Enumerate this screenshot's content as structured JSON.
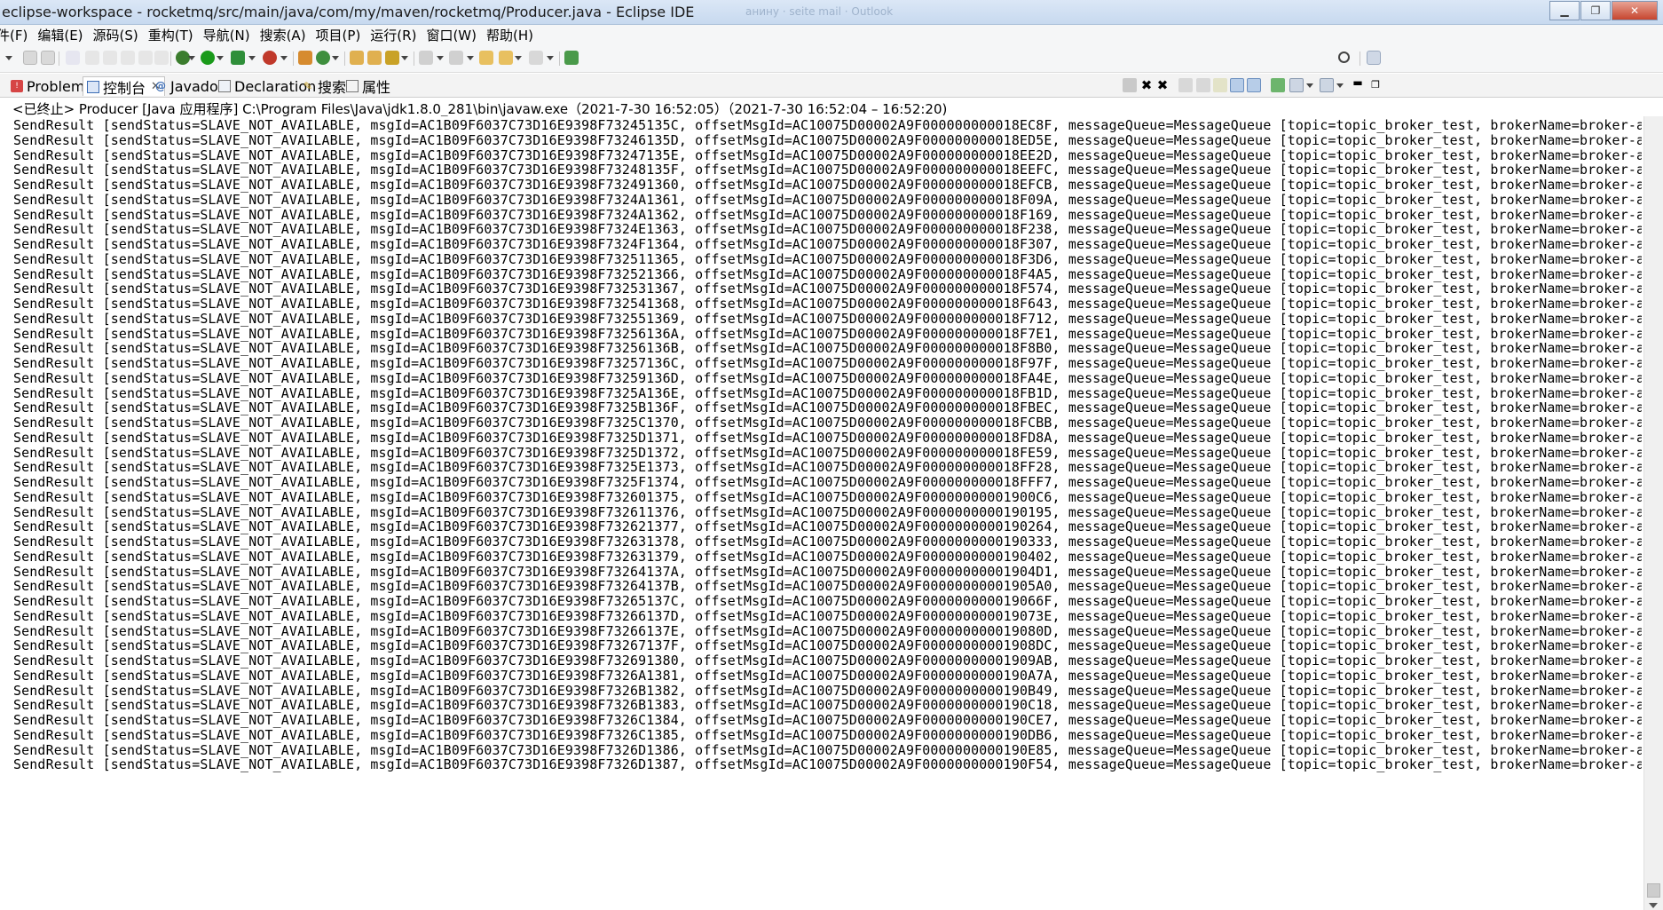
{
  "window": {
    "title": "eclipse-workspace - rocketmq/src/main/java/com/my/maven/rocketmq/Producer.java - Eclipse IDE",
    "ghost_text": "анину · seite mail · Outlook",
    "minimize_icon": "minimize-icon",
    "maximize_icon": "maximize-icon",
    "close_icon": "close-icon"
  },
  "menubar": {
    "items": [
      "件(F)",
      "编辑(E)",
      "源码(S)",
      "重构(T)",
      "导航(N)",
      "搜索(A)",
      "项目(P)",
      "运行(R)",
      "窗口(W)",
      "帮助(H)"
    ]
  },
  "toolbar": {
    "icons": [
      "new-icon",
      "save-icon",
      "save-all-icon",
      "debug-icon",
      "run-icon",
      "coverage-icon",
      "external-tools-icon",
      "new-java-project-icon",
      "new-class-icon",
      "open-type-icon",
      "search-icon",
      "next-annotation-icon",
      "back-icon",
      "forward-icon",
      "pin-editor-icon",
      "quick-access-search-icon",
      "perspective-icon"
    ]
  },
  "views": {
    "tabs": [
      {
        "label": "Problems",
        "icon": "problems-icon",
        "active": false
      },
      {
        "label": "控制台",
        "icon": "console-icon",
        "active": true
      },
      {
        "label": "Javadoc",
        "icon": "javadoc-icon",
        "active": false
      },
      {
        "label": "Declaration",
        "icon": "declaration-icon",
        "active": false
      },
      {
        "label": "搜索",
        "icon": "search-view-icon",
        "active": false
      },
      {
        "label": "属性",
        "icon": "properties-icon",
        "active": false
      }
    ],
    "close_glyph": "✕",
    "toolbar_icons": [
      "terminate-icon",
      "remove-launch-icon",
      "remove-all-terminated-icon",
      "clear-console-icon",
      "scroll-lock-icon",
      "word-wrap-icon",
      "show-on-stdout-icon",
      "show-on-stderr-icon",
      "pin-console-icon",
      "display-console-icon",
      "open-console-icon",
      "minimize-view-icon",
      "maximize-view-icon"
    ]
  },
  "console": {
    "header": "<已终止> Producer [Java 应用程序] C:\\Program Files\\Java\\jdk1.8.0_281\\bin\\javaw.exe（2021-7-30 16:52:05）（2021-7-30 16:52:04 – 16:52:20)",
    "lines": [
      "SendResult [sendStatus=SLAVE_NOT_AVAILABLE, msgId=AC1B09F6037C73D16E9398F73245135C, offsetMsgId=AC10075D00002A9F000000000018EC8F, messageQueue=MessageQueue [topic=topic_broker_test, brokerName=broker-a,",
      "SendResult [sendStatus=SLAVE_NOT_AVAILABLE, msgId=AC1B09F6037C73D16E9398F73246135D, offsetMsgId=AC10075D00002A9F000000000018ED5E, messageQueue=MessageQueue [topic=topic_broker_test, brokerName=broker-a,",
      "SendResult [sendStatus=SLAVE_NOT_AVAILABLE, msgId=AC1B09F6037C73D16E9398F73247135E, offsetMsgId=AC10075D00002A9F000000000018EE2D, messageQueue=MessageQueue [topic=topic_broker_test, brokerName=broker-a,",
      "SendResult [sendStatus=SLAVE_NOT_AVAILABLE, msgId=AC1B09F6037C73D16E9398F73248135F, offsetMsgId=AC10075D00002A9F000000000018EEFC, messageQueue=MessageQueue [topic=topic_broker_test, brokerName=broker-a,",
      "SendResult [sendStatus=SLAVE_NOT_AVAILABLE, msgId=AC1B09F6037C73D16E9398F732491360, offsetMsgId=AC10075D00002A9F000000000018EFCB, messageQueue=MessageQueue [topic=topic_broker_test, brokerName=broker-a,",
      "SendResult [sendStatus=SLAVE_NOT_AVAILABLE, msgId=AC1B09F6037C73D16E9398F7324A1361, offsetMsgId=AC10075D00002A9F000000000018F09A, messageQueue=MessageQueue [topic=topic_broker_test, brokerName=broker-a,",
      "SendResult [sendStatus=SLAVE_NOT_AVAILABLE, msgId=AC1B09F6037C73D16E9398F7324A1362, offsetMsgId=AC10075D00002A9F000000000018F169, messageQueue=MessageQueue [topic=topic_broker_test, brokerName=broker-a,",
      "SendResult [sendStatus=SLAVE_NOT_AVAILABLE, msgId=AC1B09F6037C73D16E9398F7324E1363, offsetMsgId=AC10075D00002A9F000000000018F238, messageQueue=MessageQueue [topic=topic_broker_test, brokerName=broker-a,",
      "SendResult [sendStatus=SLAVE_NOT_AVAILABLE, msgId=AC1B09F6037C73D16E9398F7324F1364, offsetMsgId=AC10075D00002A9F000000000018F307, messageQueue=MessageQueue [topic=topic_broker_test, brokerName=broker-a,",
      "SendResult [sendStatus=SLAVE_NOT_AVAILABLE, msgId=AC1B09F6037C73D16E9398F732511365, offsetMsgId=AC10075D00002A9F000000000018F3D6, messageQueue=MessageQueue [topic=topic_broker_test, brokerName=broker-a,",
      "SendResult [sendStatus=SLAVE_NOT_AVAILABLE, msgId=AC1B09F6037C73D16E9398F732521366, offsetMsgId=AC10075D00002A9F000000000018F4A5, messageQueue=MessageQueue [topic=topic_broker_test, brokerName=broker-a,",
      "SendResult [sendStatus=SLAVE_NOT_AVAILABLE, msgId=AC1B09F6037C73D16E9398F732531367, offsetMsgId=AC10075D00002A9F000000000018F574, messageQueue=MessageQueue [topic=topic_broker_test, brokerName=broker-a,",
      "SendResult [sendStatus=SLAVE_NOT_AVAILABLE, msgId=AC1B09F6037C73D16E9398F732541368, offsetMsgId=AC10075D00002A9F000000000018F643, messageQueue=MessageQueue [topic=topic_broker_test, brokerName=broker-a,",
      "SendResult [sendStatus=SLAVE_NOT_AVAILABLE, msgId=AC1B09F6037C73D16E9398F732551369, offsetMsgId=AC10075D00002A9F000000000018F712, messageQueue=MessageQueue [topic=topic_broker_test, brokerName=broker-a,",
      "SendResult [sendStatus=SLAVE_NOT_AVAILABLE, msgId=AC1B09F6037C73D16E9398F73256136A, offsetMsgId=AC10075D00002A9F000000000018F7E1, messageQueue=MessageQueue [topic=topic_broker_test, brokerName=broker-a,",
      "SendResult [sendStatus=SLAVE_NOT_AVAILABLE, msgId=AC1B09F6037C73D16E9398F73256136B, offsetMsgId=AC10075D00002A9F000000000018F8B0, messageQueue=MessageQueue [topic=topic_broker_test, brokerName=broker-a,",
      "SendResult [sendStatus=SLAVE_NOT_AVAILABLE, msgId=AC1B09F6037C73D16E9398F73257136C, offsetMsgId=AC10075D00002A9F000000000018F97F, messageQueue=MessageQueue [topic=topic_broker_test, brokerName=broker-a,",
      "SendResult [sendStatus=SLAVE_NOT_AVAILABLE, msgId=AC1B09F6037C73D16E9398F73259136D, offsetMsgId=AC10075D00002A9F000000000018FA4E, messageQueue=MessageQueue [topic=topic_broker_test, brokerName=broker-a,",
      "SendResult [sendStatus=SLAVE_NOT_AVAILABLE, msgId=AC1B09F6037C73D16E9398F7325A136E, offsetMsgId=AC10075D00002A9F000000000018FB1D, messageQueue=MessageQueue [topic=topic_broker_test, brokerName=broker-a,",
      "SendResult [sendStatus=SLAVE_NOT_AVAILABLE, msgId=AC1B09F6037C73D16E9398F7325B136F, offsetMsgId=AC10075D00002A9F000000000018FBEC, messageQueue=MessageQueue [topic=topic_broker_test, brokerName=broker-a,",
      "SendResult [sendStatus=SLAVE_NOT_AVAILABLE, msgId=AC1B09F6037C73D16E9398F7325C1370, offsetMsgId=AC10075D00002A9F000000000018FCBB, messageQueue=MessageQueue [topic=topic_broker_test, brokerName=broker-a,",
      "SendResult [sendStatus=SLAVE_NOT_AVAILABLE, msgId=AC1B09F6037C73D16E9398F7325D1371, offsetMsgId=AC10075D00002A9F000000000018FD8A, messageQueue=MessageQueue [topic=topic_broker_test, brokerName=broker-a,",
      "SendResult [sendStatus=SLAVE_NOT_AVAILABLE, msgId=AC1B09F6037C73D16E9398F7325D1372, offsetMsgId=AC10075D00002A9F000000000018FE59, messageQueue=MessageQueue [topic=topic_broker_test, brokerName=broker-a,",
      "SendResult [sendStatus=SLAVE_NOT_AVAILABLE, msgId=AC1B09F6037C73D16E9398F7325E1373, offsetMsgId=AC10075D00002A9F000000000018FF28, messageQueue=MessageQueue [topic=topic_broker_test, brokerName=broker-a,",
      "SendResult [sendStatus=SLAVE_NOT_AVAILABLE, msgId=AC1B09F6037C73D16E9398F7325F1374, offsetMsgId=AC10075D00002A9F000000000018FFF7, messageQueue=MessageQueue [topic=topic_broker_test, brokerName=broker-a,",
      "SendResult [sendStatus=SLAVE_NOT_AVAILABLE, msgId=AC1B09F6037C73D16E9398F732601375, offsetMsgId=AC10075D00002A9F00000000001900C6, messageQueue=MessageQueue [topic=topic_broker_test, brokerName=broker-a,",
      "SendResult [sendStatus=SLAVE_NOT_AVAILABLE, msgId=AC1B09F6037C73D16E9398F732611376, offsetMsgId=AC10075D00002A9F0000000000190195, messageQueue=MessageQueue [topic=topic_broker_test, brokerName=broker-a,",
      "SendResult [sendStatus=SLAVE_NOT_AVAILABLE, msgId=AC1B09F6037C73D16E9398F732621377, offsetMsgId=AC10075D00002A9F0000000000190264, messageQueue=MessageQueue [topic=topic_broker_test, brokerName=broker-a,",
      "SendResult [sendStatus=SLAVE_NOT_AVAILABLE, msgId=AC1B09F6037C73D16E9398F732631378, offsetMsgId=AC10075D00002A9F0000000000190333, messageQueue=MessageQueue [topic=topic_broker_test, brokerName=broker-a,",
      "SendResult [sendStatus=SLAVE_NOT_AVAILABLE, msgId=AC1B09F6037C73D16E9398F732631379, offsetMsgId=AC10075D00002A9F0000000000190402, messageQueue=MessageQueue [topic=topic_broker_test, brokerName=broker-a,",
      "SendResult [sendStatus=SLAVE_NOT_AVAILABLE, msgId=AC1B09F6037C73D16E9398F73264137A, offsetMsgId=AC10075D00002A9F00000000001904D1, messageQueue=MessageQueue [topic=topic_broker_test, brokerName=broker-a,",
      "SendResult [sendStatus=SLAVE_NOT_AVAILABLE, msgId=AC1B09F6037C73D16E9398F73264137B, offsetMsgId=AC10075D00002A9F00000000001905A0, messageQueue=MessageQueue [topic=topic_broker_test, brokerName=broker-a,",
      "SendResult [sendStatus=SLAVE_NOT_AVAILABLE, msgId=AC1B09F6037C73D16E9398F73265137C, offsetMsgId=AC10075D00002A9F000000000019066F, messageQueue=MessageQueue [topic=topic_broker_test, brokerName=broker-a,",
      "SendResult [sendStatus=SLAVE_NOT_AVAILABLE, msgId=AC1B09F6037C73D16E9398F73266137D, offsetMsgId=AC10075D00002A9F000000000019073E, messageQueue=MessageQueue [topic=topic_broker_test, brokerName=broker-a,",
      "SendResult [sendStatus=SLAVE_NOT_AVAILABLE, msgId=AC1B09F6037C73D16E9398F73266137E, offsetMsgId=AC10075D00002A9F000000000019080D, messageQueue=MessageQueue [topic=topic_broker_test, brokerName=broker-a,",
      "SendResult [sendStatus=SLAVE_NOT_AVAILABLE, msgId=AC1B09F6037C73D16E9398F73267137F, offsetMsgId=AC10075D00002A9F00000000001908DC, messageQueue=MessageQueue [topic=topic_broker_test, brokerName=broker-a,",
      "SendResult [sendStatus=SLAVE_NOT_AVAILABLE, msgId=AC1B09F6037C73D16E9398F732691380, offsetMsgId=AC10075D00002A9F00000000001909AB, messageQueue=MessageQueue [topic=topic_broker_test, brokerName=broker-a,",
      "SendResult [sendStatus=SLAVE_NOT_AVAILABLE, msgId=AC1B09F6037C73D16E9398F7326A1381, offsetMsgId=AC10075D00002A9F0000000000190A7A, messageQueue=MessageQueue [topic=topic_broker_test, brokerName=broker-a,",
      "SendResult [sendStatus=SLAVE_NOT_AVAILABLE, msgId=AC1B09F6037C73D16E9398F7326B1382, offsetMsgId=AC10075D00002A9F0000000000190B49, messageQueue=MessageQueue [topic=topic_broker_test, brokerName=broker-a,",
      "SendResult [sendStatus=SLAVE_NOT_AVAILABLE, msgId=AC1B09F6037C73D16E9398F7326B1383, offsetMsgId=AC10075D00002A9F0000000000190C18, messageQueue=MessageQueue [topic=topic_broker_test, brokerName=broker-a,",
      "SendResult [sendStatus=SLAVE_NOT_AVAILABLE, msgId=AC1B09F6037C73D16E9398F7326C1384, offsetMsgId=AC10075D00002A9F0000000000190CE7, messageQueue=MessageQueue [topic=topic_broker_test, brokerName=broker-a,",
      "SendResult [sendStatus=SLAVE_NOT_AVAILABLE, msgId=AC1B09F6037C73D16E9398F7326C1385, offsetMsgId=AC10075D00002A9F0000000000190DB6, messageQueue=MessageQueue [topic=topic_broker_test, brokerName=broker-a,",
      "SendResult [sendStatus=SLAVE_NOT_AVAILABLE, msgId=AC1B09F6037C73D16E9398F7326D1386, offsetMsgId=AC10075D00002A9F0000000000190E85, messageQueue=MessageQueue [topic=topic_broker_test, brokerName=broker-a,",
      "SendResult [sendStatus=SLAVE_NOT_AVAILABLE, msgId=AC1B09F6037C73D16E9398F7326D1387, offsetMsgId=AC10075D00002A9F0000000000190F54, messageQueue=MessageQueue [topic=topic_broker_test, brokerName=broker-a,"
    ]
  },
  "colors": {
    "run": "#1a9a1a",
    "debug": "#3b7d2e",
    "title_bar": "#c7d9ef",
    "active_view_icon": "#3c6db5"
  }
}
